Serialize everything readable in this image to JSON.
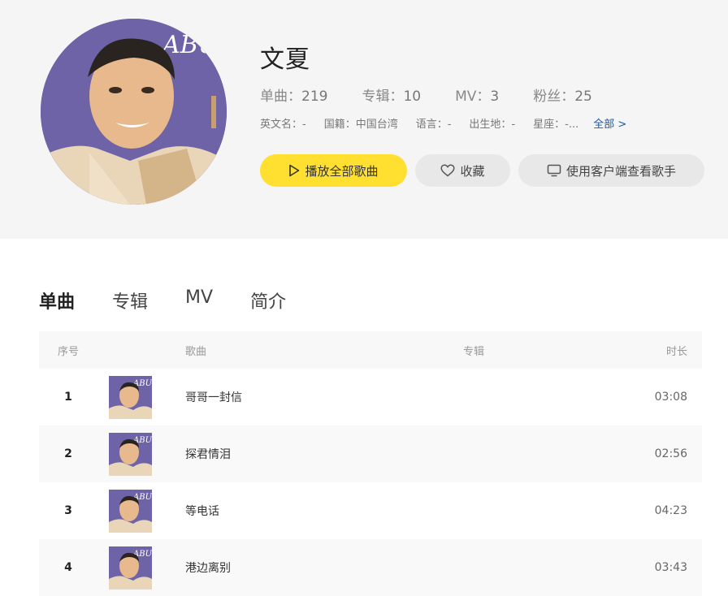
{
  "artist": {
    "name": "文夏",
    "avatar_text": "ABU",
    "stats": [
      {
        "label": "单曲：",
        "value": "219"
      },
      {
        "label": "专辑：",
        "value": "10"
      },
      {
        "label": "MV：",
        "value": "3"
      },
      {
        "label": "粉丝：",
        "value": "25"
      }
    ],
    "meta": {
      "english_name": "英文名：-",
      "nationality": "国籍：中国台湾",
      "language": "语言：-",
      "birthplace": "出生地：-",
      "constellation": "星座：-...",
      "more": "全部 >"
    }
  },
  "actions": {
    "play_all": "播放全部歌曲",
    "favorite": "收藏",
    "client": "使用客户端查看歌手"
  },
  "tabs": [
    "单曲",
    "专辑",
    "MV",
    "简介"
  ],
  "table": {
    "headers": {
      "index": "序号",
      "song": "歌曲",
      "album": "专辑",
      "duration": "时长"
    },
    "rows": [
      {
        "index": "1",
        "title": "哥哥一封信",
        "album": "",
        "duration": "03:08"
      },
      {
        "index": "2",
        "title": "探君情泪",
        "album": "",
        "duration": "02:56"
      },
      {
        "index": "3",
        "title": "等电话",
        "album": "",
        "duration": "04:23"
      },
      {
        "index": "4",
        "title": "港边离别",
        "album": "",
        "duration": "03:43"
      }
    ]
  },
  "colors": {
    "accent": "#ffe030",
    "hero_bg": "#f5f5f5",
    "cover_bg": "#6f63a8"
  }
}
